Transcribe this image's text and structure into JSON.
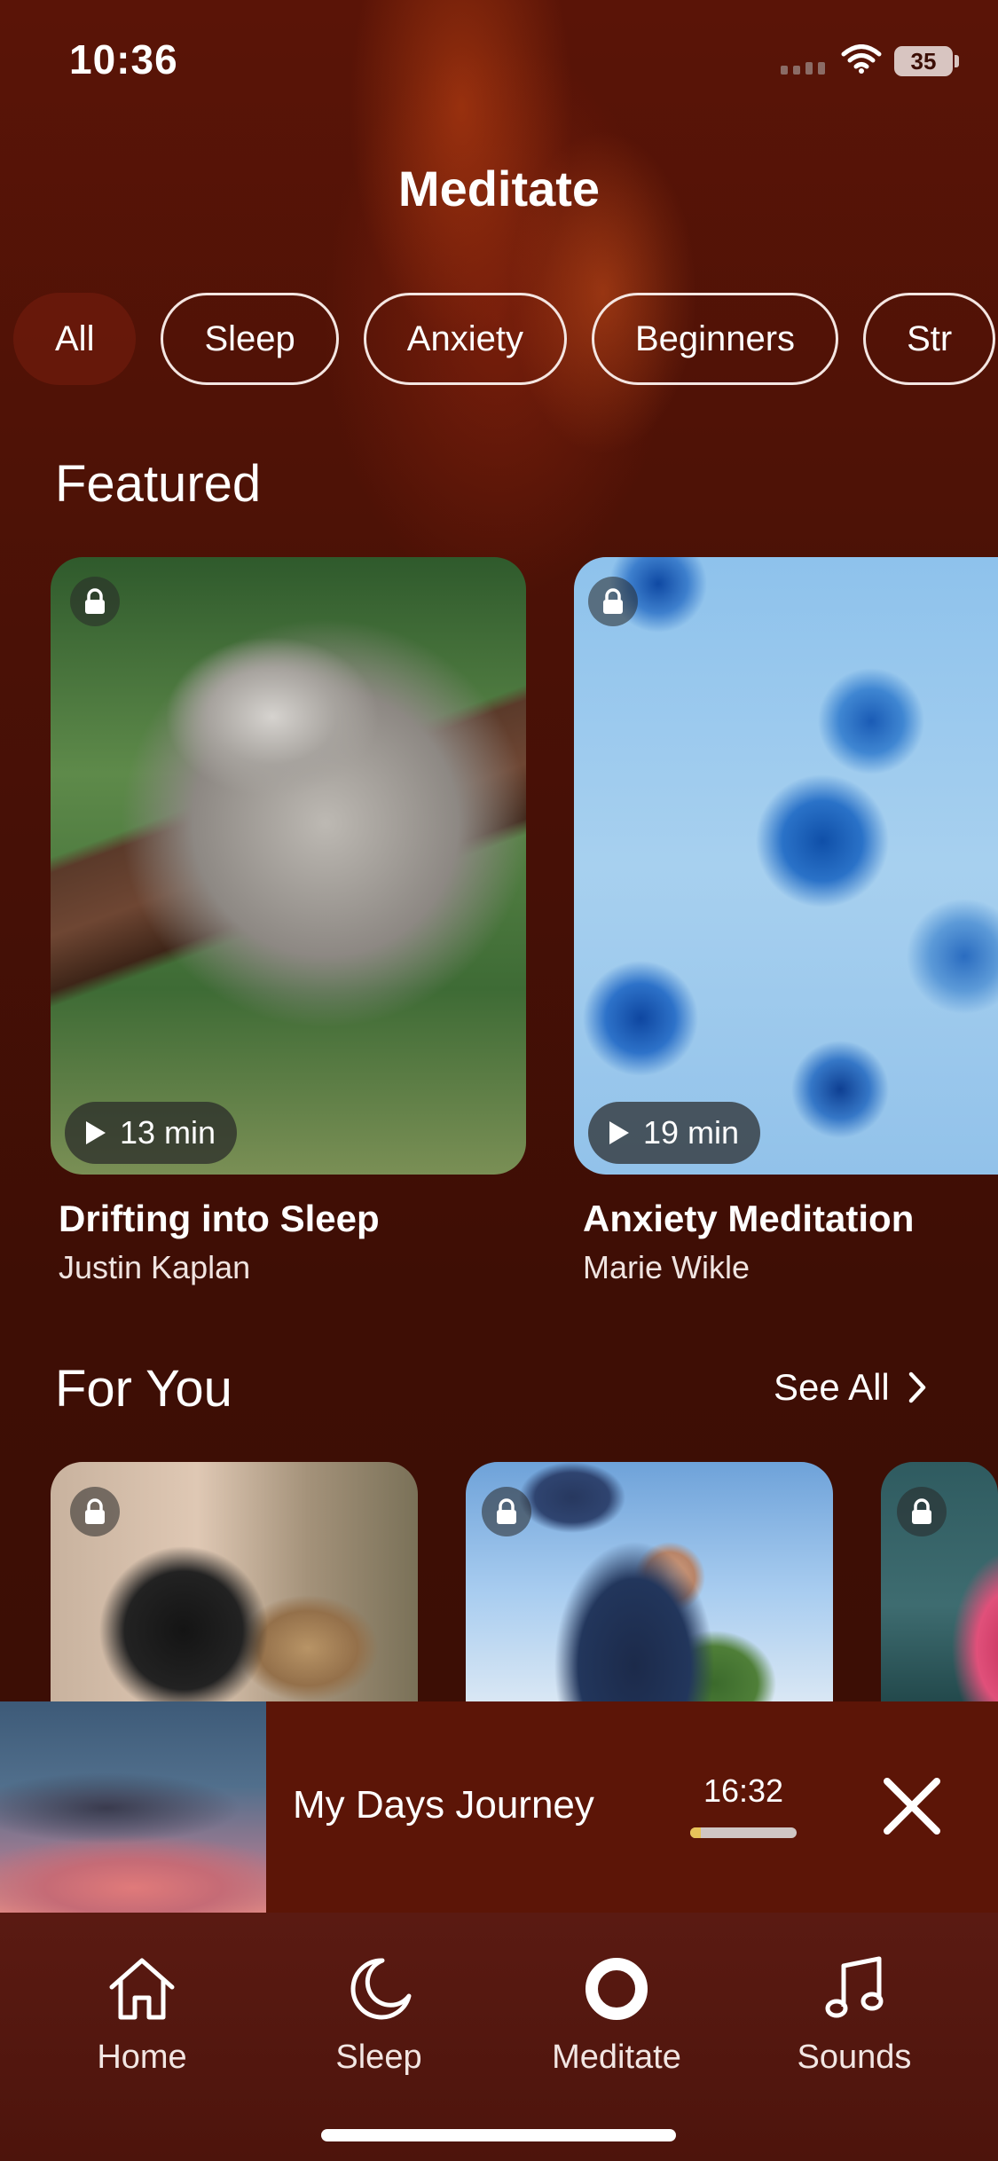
{
  "status_bar": {
    "time": "10:36",
    "battery": "35"
  },
  "header": {
    "title": "Meditate"
  },
  "filters": [
    "All",
    "Sleep",
    "Anxiety",
    "Beginners",
    "Str"
  ],
  "featured": {
    "title": "Featured",
    "cards": [
      {
        "title": "Drifting into Sleep",
        "author": "Justin Kaplan",
        "duration": "13 min",
        "locked": true,
        "image": "sleeping-koala"
      },
      {
        "title": "Anxiety Meditation",
        "author": "Marie Wikle",
        "duration": "19 min",
        "locked": true,
        "image": "blue-jellyfish"
      }
    ]
  },
  "for_you": {
    "title": "For You",
    "see_all": "See All",
    "cards": [
      {
        "image": "alarm-clock",
        "locked": true
      },
      {
        "image": "father-lifting-baby",
        "locked": true
      },
      {
        "image": "pink-lotus",
        "locked": true
      }
    ]
  },
  "mini_player": {
    "title": "My Days Journey",
    "time": "16:32",
    "progress": 0.1,
    "progress_color": "#e8c45a"
  },
  "tab_bar": {
    "items": [
      {
        "label": "Home",
        "icon": "house-icon"
      },
      {
        "label": "Sleep",
        "icon": "moon-icon"
      },
      {
        "label": "Meditate",
        "icon": "circle-icon",
        "active": true
      },
      {
        "label": "Sounds",
        "icon": "music-note-icon"
      }
    ]
  },
  "colors": {
    "background": "#3f0f06",
    "player_bg": "#5c1507",
    "tab_bar_bg": "#4d140c"
  }
}
